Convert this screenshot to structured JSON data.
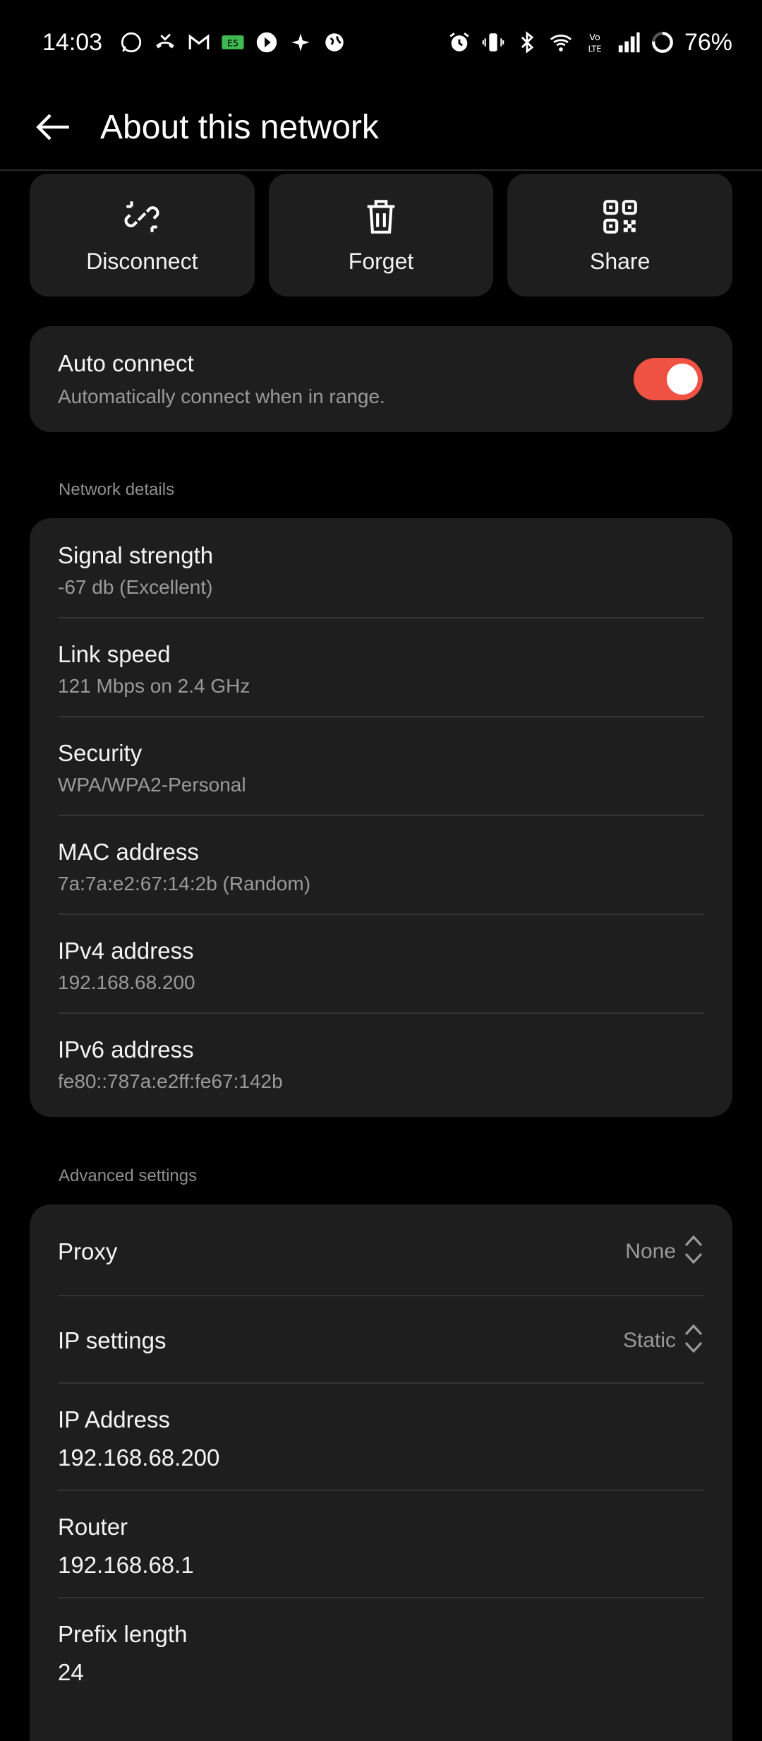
{
  "status_bar": {
    "time": "14:03",
    "battery_percent": "76%",
    "left_icons": [
      "whatsapp-icon",
      "missed-call-icon",
      "gmail-icon",
      "app-badge-icon",
      "play-icon",
      "sparkle-icon",
      "globe-icon"
    ],
    "right_icons": [
      "alarm-icon",
      "vibrate-icon",
      "bluetooth-icon",
      "wifi-icon",
      "volte-icon",
      "signal-icon",
      "battery-ring-icon"
    ]
  },
  "header": {
    "title": "About this network"
  },
  "actions": [
    {
      "label": "Disconnect",
      "icon": "broken-link-icon"
    },
    {
      "label": "Forget",
      "icon": "trash-icon"
    },
    {
      "label": "Share",
      "icon": "qr-code-icon"
    }
  ],
  "auto_connect": {
    "title": "Auto connect",
    "subtitle": "Automatically connect when in range.",
    "enabled": true
  },
  "network_details": {
    "label": "Network details",
    "rows": [
      {
        "title": "Signal strength",
        "value": "-67 db (Excellent)"
      },
      {
        "title": "Link speed",
        "value": "121 Mbps on 2.4 GHz"
      },
      {
        "title": "Security",
        "value": "WPA/WPA2-Personal"
      },
      {
        "title": "MAC address",
        "value": "7a:7a:e2:67:14:2b (Random)"
      },
      {
        "title": "IPv4 address",
        "value": "192.168.68.200"
      },
      {
        "title": "IPv6 address",
        "value": "fe80::787a:e2ff:fe67:142b"
      }
    ]
  },
  "advanced_settings": {
    "label": "Advanced settings",
    "proxy": {
      "title": "Proxy",
      "value": "None"
    },
    "ip_settings": {
      "title": "IP settings",
      "value": "Static"
    },
    "ip_address": {
      "title": "IP Address",
      "value": "192.168.68.200"
    },
    "router": {
      "title": "Router",
      "value": "192.168.68.1"
    },
    "prefix_length": {
      "title": "Prefix length",
      "value": "24"
    }
  },
  "colors": {
    "accent": "#ef5143",
    "card": "#1e1e1e",
    "background": "#000000"
  }
}
